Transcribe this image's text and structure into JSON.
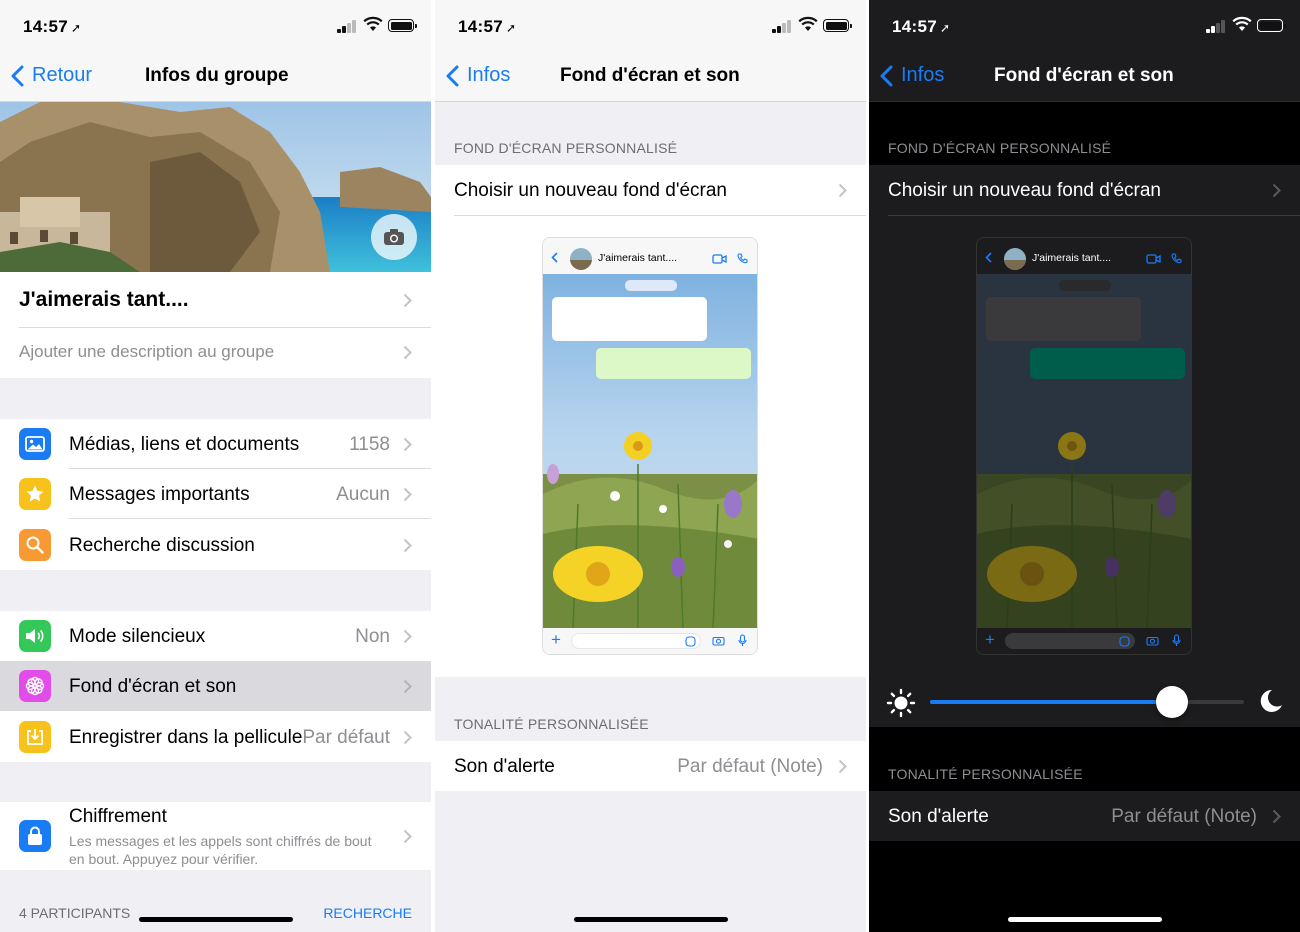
{
  "panel1": {
    "status": {
      "time": "14:57",
      "loc_icon": "location-arrow-icon"
    },
    "nav": {
      "back": "Retour",
      "title": "Infos du groupe"
    },
    "group_name": "J'aimerais tant....",
    "description_placeholder": "Ajouter une description au groupe",
    "rows": [
      {
        "label": "Médias, liens et documents",
        "value": "1158",
        "icon": "photo-icon",
        "color": "#1a7cf5"
      },
      {
        "label": "Messages importants",
        "value": "Aucun",
        "icon": "star-icon",
        "color": "#f7c21c"
      },
      {
        "label": "Recherche discussion",
        "value": "",
        "icon": "search-icon",
        "color": "#f79a33"
      },
      {
        "label": "Mode silencieux",
        "value": "Non",
        "icon": "speaker-icon",
        "color": "#34c759"
      },
      {
        "label": "Fond d'écran et son",
        "value": "",
        "icon": "flower-icon",
        "color": "#e24ce9"
      },
      {
        "label": "Enregistrer dans la pellicule",
        "value": "Par défaut",
        "icon": "save-icon",
        "color": "#f7c21c"
      }
    ],
    "encryption": {
      "title": "Chiffrement",
      "desc_line1": "Les messages et les appels sont chiffrés de bout",
      "desc_line2": "en bout. Appuyez pour vérifier."
    },
    "participants_label": "4 PARTICIPANTS",
    "search_label": "RECHERCHE"
  },
  "panel2": {
    "status": {
      "time": "14:57"
    },
    "nav": {
      "back": "Infos",
      "title": "Fond d'écran et son"
    },
    "wallpaper_section": "FOND D'ÉCRAN PERSONNALISÉ",
    "choose_wallpaper": "Choisir un nouveau fond d'écran",
    "preview_name": "J'aimerais tant....",
    "tone_section": "TONALITÉ PERSONNALISÉE",
    "alert_label": "Son d'alerte",
    "alert_value": "Par défaut (Note)"
  },
  "panel3": {
    "status": {
      "time": "14:57"
    },
    "nav": {
      "back": "Infos",
      "title": "Fond d'écran et son"
    },
    "wallpaper_section": "FOND D'ÉCRAN PERSONNALISÉ",
    "choose_wallpaper": "Choisir un nouveau fond d'écran",
    "preview_name": "J'aimerais tant....",
    "dimming_level": 0.77,
    "tone_section": "TONALITÉ PERSONNALISÉE",
    "alert_label": "Son d'alerte",
    "alert_value": "Par défaut (Note)"
  },
  "colors": {
    "accent": "#1a7cf5",
    "selected_row": "#d9d9de",
    "green_bubble": "#dcf8c6",
    "dark_green_bubble": "#005c4b"
  }
}
